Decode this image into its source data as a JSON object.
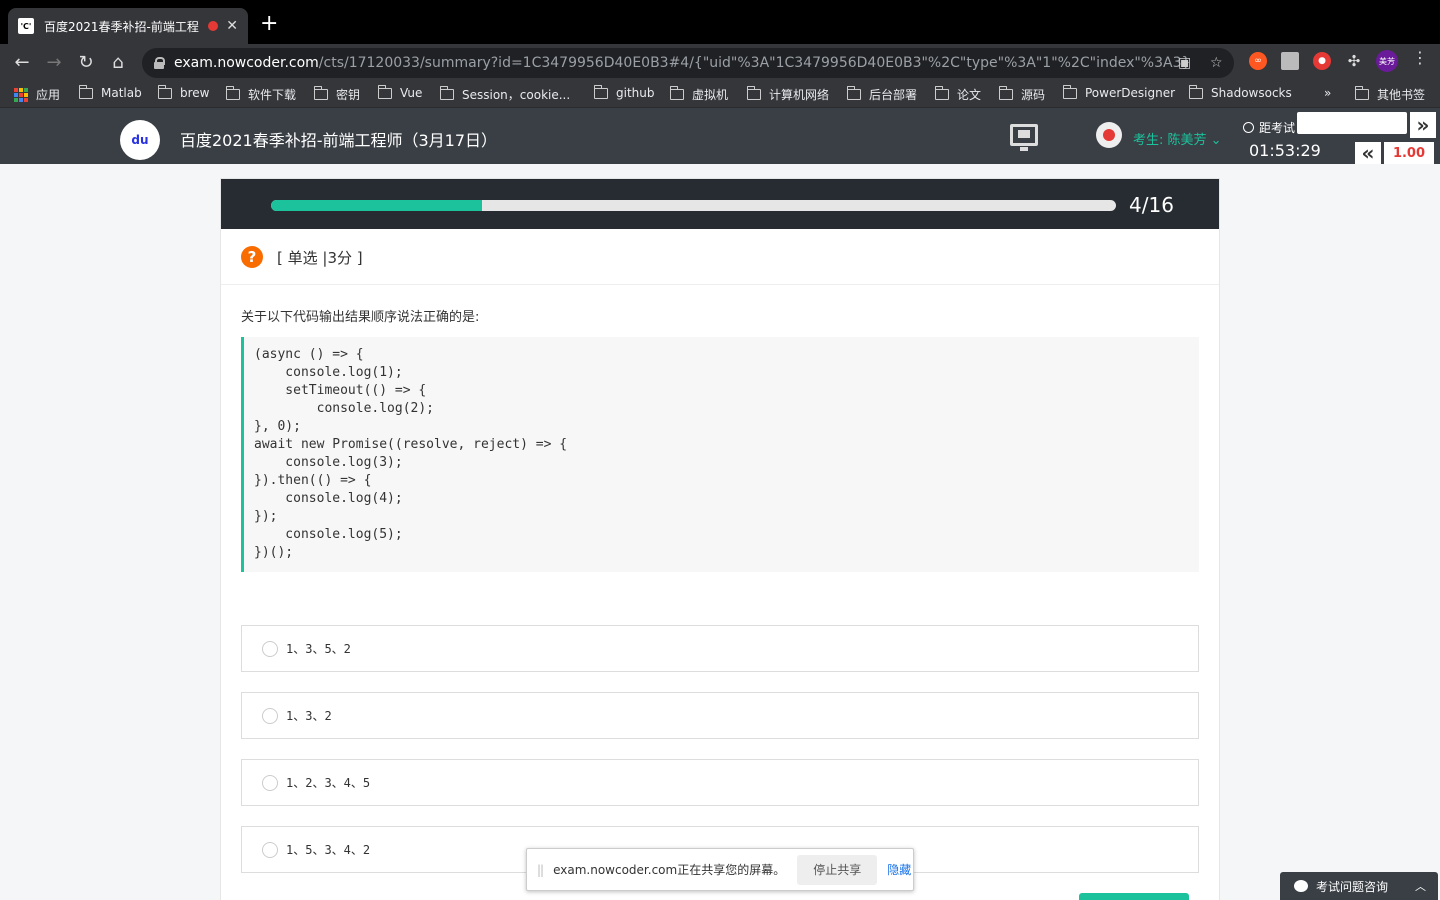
{
  "browser": {
    "tab_title": "百度2021春季补招-前端工程",
    "tab_favicon": "'C'",
    "new_tab": "+",
    "url_host": "exam.nowcoder.com",
    "url_path": "/cts/17120033/summary?id=1C3479956D40E0B3#4/{\"uid\"%3A\"1C3479956D40E0B3\"%2C\"type\"%3A\"1\"%2C\"index\"%3A3}",
    "avatar_label": "美芳",
    "bookmarks": [
      "应用",
      "Matlab",
      "brew",
      "软件下载",
      "密钥",
      "Vue",
      "Session，cookie...",
      "github",
      "虚拟机",
      "计算机网络",
      "后台部署",
      "论文",
      "源码",
      "PowerDesigner",
      "Shadowsocks",
      "»",
      "其他书签"
    ]
  },
  "header": {
    "logo": "du",
    "title": "百度2021春季补招-前端工程师（3月17日）",
    "examinee": "考生: 陈美芳 ⌄",
    "countdown_label": "距考试",
    "timer": "01:53:29",
    "score": "1.00",
    "expand": "»",
    "collapse": "«"
  },
  "progress": {
    "current": 4,
    "total": 16,
    "label": "4/16",
    "fraction": 0.25
  },
  "question": {
    "type": "[ 单选 |3分 ]",
    "text": "关于以下代码输出结果顺序说法正确的是:",
    "code": "(async () => {\n    console.log(1);\n    setTimeout(() => {\n        console.log(2);\n}, 0);\nawait new Promise((resolve, reject) => {\n    console.log(3);\n}).then(() => {\n    console.log(4);\n});\n    console.log(5);\n})();",
    "options": [
      "1、3、5、2",
      "1、3、2",
      "1、2、3、4、5",
      "1、5、3、4、2"
    ]
  },
  "share_bar": {
    "message": "exam.nowcoder.com正在共享您的屏幕。",
    "stop": "停止共享",
    "hide": "隐藏"
  },
  "help": {
    "label": "考试问题咨询"
  },
  "colors": {
    "accent": "#1bc29c",
    "header_bg": "#3a3f45",
    "progress_bg": "#262c31",
    "question_icon": "#f96d00"
  }
}
